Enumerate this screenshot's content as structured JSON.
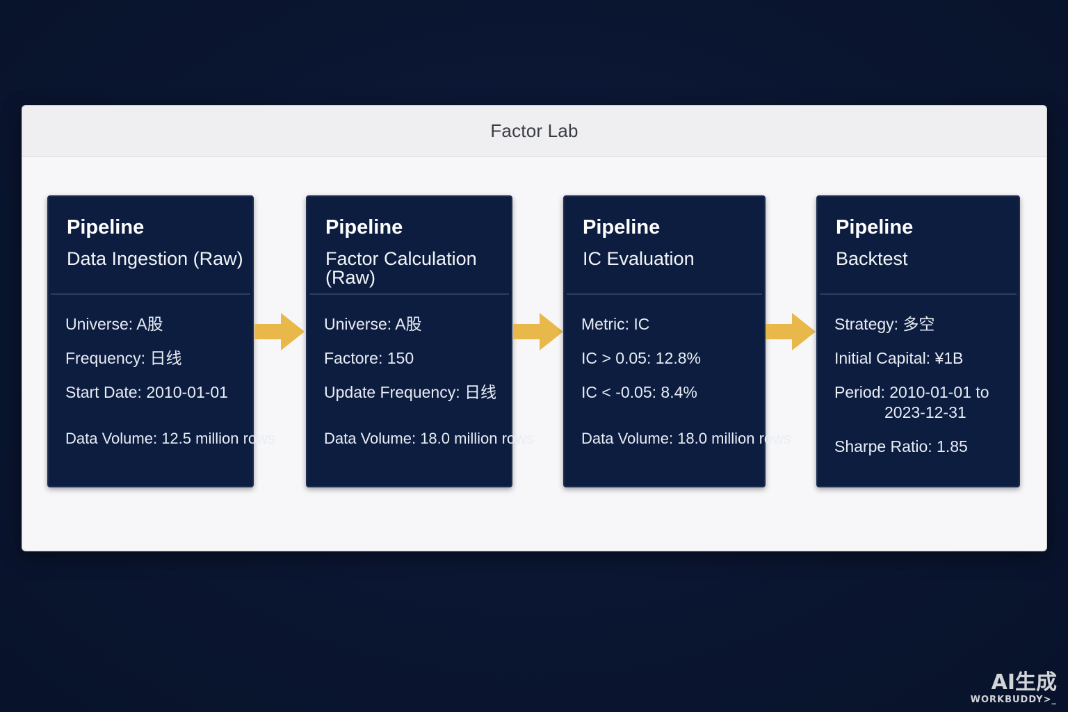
{
  "window": {
    "title": "Factor Lab"
  },
  "stages": [
    {
      "kind": "Pipeline",
      "name": "Data Ingestion (Raw)",
      "rows": [
        "Universe: A股",
        "Frequency: 日线",
        "Start Date: 2010-01-01"
      ],
      "volume": "Data Volume: 12.5 million rows"
    },
    {
      "kind": "Pipeline",
      "name": "Factor Calculation (Raw)",
      "rows": [
        "Universe: A股",
        "Factore: 150",
        "Update Frequency: 日线"
      ],
      "volume": "Data Volume: 18.0 million rows"
    },
    {
      "kind": "Pipeline",
      "name": "IC Evaluation",
      "rows": [
        "Metric: IC",
        "IC > 0.05: 12.8%",
        "IC < -0.05: 8.4%"
      ],
      "volume": "Data Volume: 18.0 million rows"
    },
    {
      "kind": "Pipeline",
      "name": "Backtest",
      "rows": [
        "Strategy: 多空",
        "Initial Capital: ¥1B",
        "Period: 2010-01-01 to",
        "2023-12-31",
        "Sharpe Ratio: 1.85"
      ]
    }
  ],
  "colors": {
    "arrow": "#e9b84a",
    "card": "#0c1d3f",
    "background": "#0b1733"
  },
  "watermark": {
    "main": "AI生成",
    "sub": "WORKBUDDY>_"
  }
}
